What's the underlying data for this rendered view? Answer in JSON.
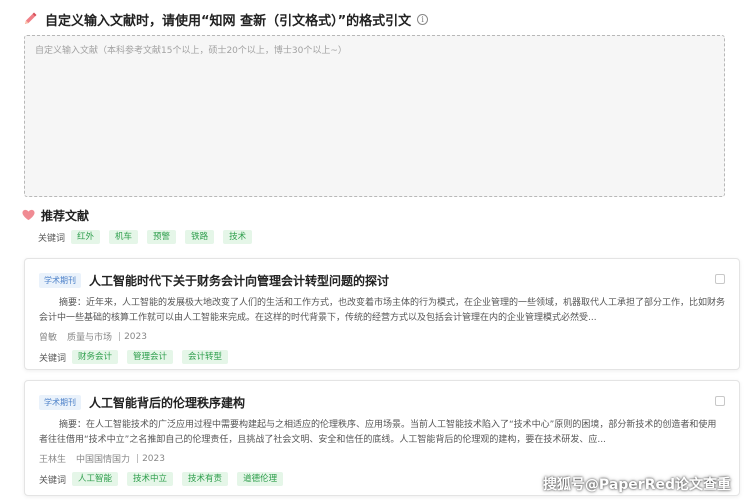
{
  "custom_section": {
    "title": "自定义输入文献时，请使用“知网 查新（引文格式）”的格式引文",
    "input_placeholder": "自定义输入文献（本科参考文献15个以上，硕士20个以上，博士30个以上~）",
    "input_value": ""
  },
  "recommend_section": {
    "title": "推荐文献",
    "partial_item": {
      "keywords_label": "关键词",
      "keywords": [
        "红外",
        "机车",
        "预警",
        "铁路",
        "技术"
      ]
    },
    "papers": [
      {
        "type_badge": "学术期刊",
        "title": "人工智能时代下关于财务会计向管理会计转型问题的探讨",
        "abstract": "摘要：近年来，人工智能的发展极大地改变了人们的生活和工作方式，也改变着市场主体的行为模式，在企业管理的一些领域，机器取代人工承担了部分工作，比如财务会计中一些基础的核算工作就可以由人工智能来完成。在这样的时代背景下，传统的经营方式以及包括会计管理在内的企业管理模式必然受...",
        "author": "曾敏",
        "journal": "质量与市场",
        "year": "2023",
        "keywords_label": "关键词",
        "keywords": [
          "财务会计",
          "管理会计",
          "会计转型"
        ]
      },
      {
        "type_badge": "学术期刊",
        "title": "人工智能背后的伦理秩序建构",
        "abstract": "摘要：在人工智能技术的广泛应用过程中需要构建起与之相适应的伦理秩序、应用场景。当前人工智能技术陷入了“技术中心”原则的困境，部分新技术的创造者和使用者往往借用“技术中立”之名推卸自己的伦理责任，且挑战了社会文明、安全和信任的底线。人工智能背后的伦理观的建构，要在技术研发、应...",
        "author": "王林生",
        "journal": "中国国情国力",
        "year": "2023",
        "keywords_label": "关键词",
        "keywords": [
          "人工智能",
          "技术中立",
          "技术有责",
          "道德伦理"
        ]
      }
    ]
  },
  "watermark": "搜狐号@PaperRed论文查重",
  "colors": {
    "tag_bg": "#e5f6e8",
    "tag_text": "#2e9e4c",
    "badge_bg": "#eaf2fb",
    "badge_text": "#4a7fc8",
    "accent_icon": "#e4626e"
  },
  "icons": [
    "pencil-icon",
    "info-icon",
    "heart-icon"
  ]
}
